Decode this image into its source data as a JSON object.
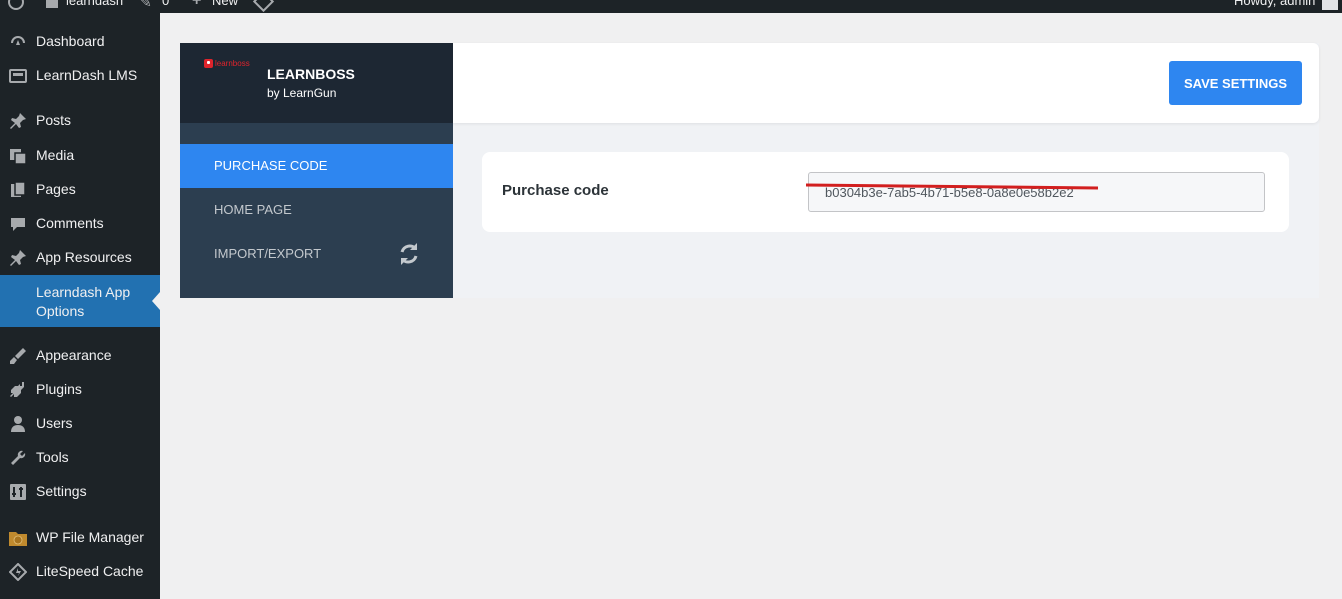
{
  "admin_bar": {
    "site_name": "learndash",
    "comments_count": "0",
    "new_label": "New",
    "howdy": "Howdy, admin"
  },
  "sidebar": {
    "items": [
      {
        "label": "Dashboard",
        "icon": "dashboard-icon"
      },
      {
        "label": "LearnDash LMS",
        "icon": "learndash-icon"
      },
      {
        "label": "Posts",
        "icon": "pin-icon"
      },
      {
        "label": "Media",
        "icon": "media-icon"
      },
      {
        "label": "Pages",
        "icon": "pages-icon"
      },
      {
        "label": "Comments",
        "icon": "comments-icon"
      },
      {
        "label": "App Resources",
        "icon": "pin-icon"
      },
      {
        "label": "Learndash App Options",
        "icon": "none",
        "active": true
      },
      {
        "label": "Appearance",
        "icon": "brush-icon"
      },
      {
        "label": "Plugins",
        "icon": "plugin-icon"
      },
      {
        "label": "Users",
        "icon": "user-icon"
      },
      {
        "label": "Tools",
        "icon": "wrench-icon"
      },
      {
        "label": "Settings",
        "icon": "settings-icon"
      },
      {
        "label": "WP File Manager",
        "icon": "file-manager-icon"
      },
      {
        "label": "LiteSpeed Cache",
        "icon": "litespeed-icon"
      }
    ]
  },
  "plugin": {
    "logo_text": "learnboss",
    "title": "LEARNBOSS",
    "subtitle": "by LearnGun",
    "nav": [
      {
        "label": "PURCHASE CODE",
        "active": true
      },
      {
        "label": "HOME PAGE",
        "active": false
      },
      {
        "label": "IMPORT/EXPORT",
        "active": false
      }
    ],
    "save_label": "SAVE SETTINGS",
    "purchase": {
      "label": "Purchase code",
      "value": "b0304b3e-7ab5-4b71-b5e8-0a8e0e58b2e2"
    }
  },
  "colors": {
    "admin_bg": "#1d2327",
    "accent": "#2e86f0",
    "wp_active": "#2271b1",
    "plugin_nav_bg": "#2c3e50",
    "redaction": "#d21f1f"
  }
}
